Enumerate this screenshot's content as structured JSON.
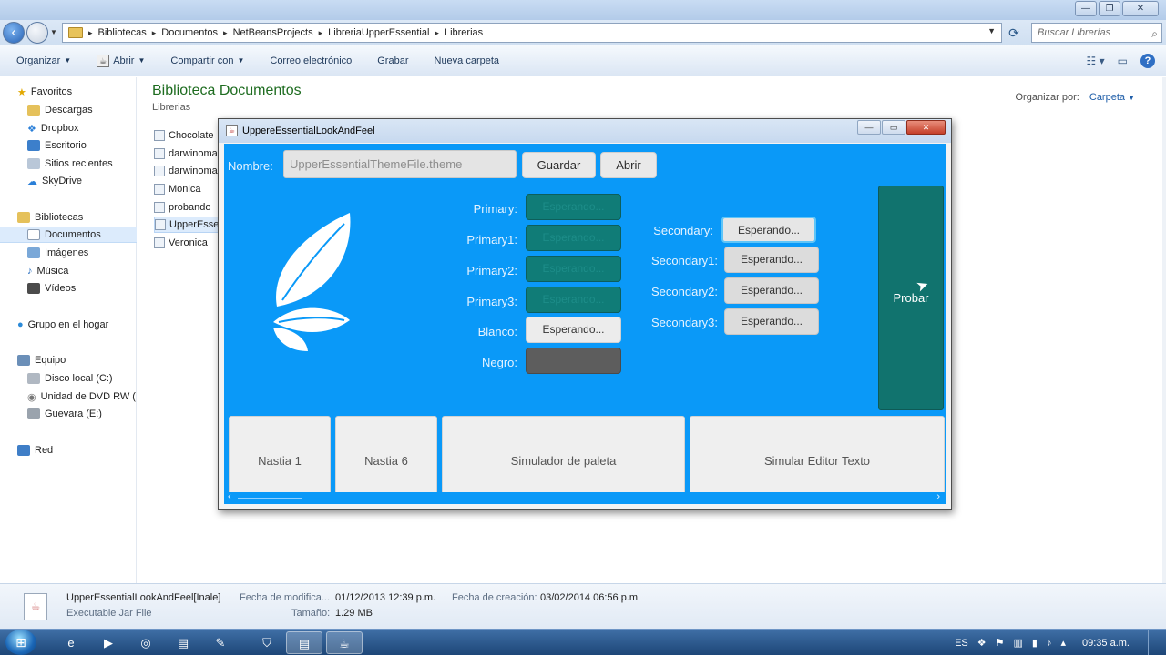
{
  "explorer": {
    "breadcrumb": [
      "Bibliotecas",
      "Documentos",
      "NetBeansProjects",
      "LibreriaUpperEssential",
      "Librerias"
    ],
    "search_placeholder": "Buscar Librerías",
    "toolbar": [
      "Organizar",
      "Abrir",
      "Compartir con",
      "Correo electrónico",
      "Grabar",
      "Nueva carpeta"
    ],
    "nav": {
      "favorites": "Favoritos",
      "fav_items": [
        "Descargas",
        "Dropbox",
        "Escritorio",
        "Sitios recientes",
        "SkyDrive"
      ],
      "libraries": "Bibliotecas",
      "lib_items": [
        "Documentos",
        "Imágenes",
        "Música",
        "Vídeos"
      ],
      "homegroup": "Grupo en el hogar",
      "computer": "Equipo",
      "computer_items": [
        "Disco local (C:)",
        "Unidad de DVD RW (",
        "Guevara (E:)"
      ],
      "network": "Red"
    },
    "library_title": "Biblioteca Documentos",
    "library_subtitle": "Librerias",
    "arrange_label": "Organizar por:",
    "arrange_value": "Carpeta",
    "files": [
      "Chocolate",
      "darwinoma",
      "darwinoma",
      "Monica",
      "probando",
      "UpperEssen",
      "Veronica"
    ],
    "details": {
      "name": "UpperEssentialLookAndFeel[Inale]",
      "type": "Executable Jar File",
      "modified_label": "Fecha de modifica...",
      "modified_value": "01/12/2013 12:39 p.m.",
      "created_label": "Fecha de creación:",
      "created_value": "03/02/2014 06:56 p.m.",
      "size_label": "Tamaño:",
      "size_value": "1.29 MB"
    }
  },
  "dialog": {
    "title": "UppereEssentialLookAndFeel",
    "name_label": "Nombre:",
    "name_value": "UpperEssentialThemeFile.theme",
    "save_button": "Guardar",
    "open_button": "Abrir",
    "primary_labels": [
      "Primary:",
      "Primary1:",
      "Primary2:",
      "Primary3:",
      "Blanco:",
      "Negro:"
    ],
    "primary_values": [
      "Esperando...",
      "Esperando...",
      "Esperando...",
      "Esperando...",
      "Esperando...",
      ""
    ],
    "secondary_labels": [
      "Secondary:",
      "Secondary1:",
      "Secondary2:",
      "Secondary3:"
    ],
    "secondary_values": [
      "Esperando...",
      "Esperando...",
      "Esperando...",
      "Esperando..."
    ],
    "test_button": "Probar",
    "tabs": [
      "Nastia 1",
      "Nastia 6",
      "Simulador de paleta",
      "Simular Editor Texto"
    ]
  },
  "taskbar": {
    "language": "ES",
    "clock": "09:35 a.m."
  },
  "colors": {
    "dialog_bg": "#0a99f8",
    "teal": "#107c77",
    "library_title": "#1e6c20"
  }
}
